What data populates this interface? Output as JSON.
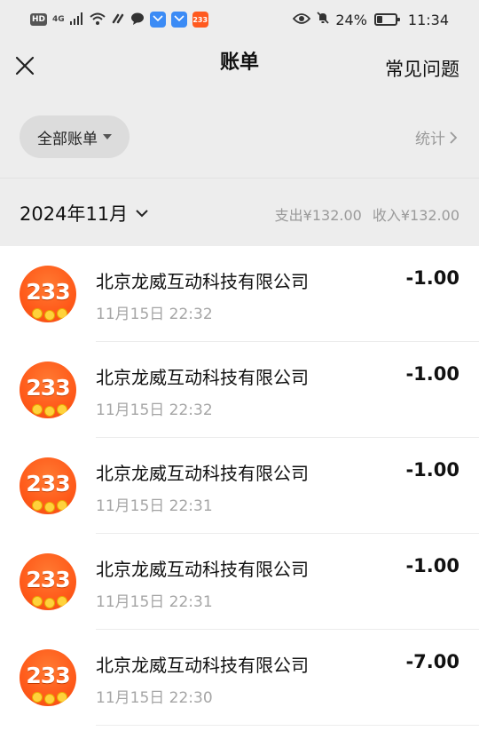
{
  "status_bar": {
    "hd": "HD",
    "network": "4G",
    "app_badge": "233",
    "battery_percent": "24%",
    "time": "11:34"
  },
  "navbar": {
    "title": "账单",
    "faq_label": "常见问题"
  },
  "filter": {
    "selected": "全部账单",
    "stats_label": "统计"
  },
  "month": {
    "label": "2024年11月",
    "expense": "支出¥132.00",
    "income": "收入¥132.00"
  },
  "bills": [
    {
      "merchant": "北京龙威互动科技有限公司",
      "time": "11月15日 22:32",
      "amount": "-1.00",
      "avatar_text": "233"
    },
    {
      "merchant": "北京龙威互动科技有限公司",
      "time": "11月15日 22:32",
      "amount": "-1.00",
      "avatar_text": "233"
    },
    {
      "merchant": "北京龙威互动科技有限公司",
      "time": "11月15日 22:31",
      "amount": "-1.00",
      "avatar_text": "233"
    },
    {
      "merchant": "北京龙威互动科技有限公司",
      "time": "11月15日 22:31",
      "amount": "-1.00",
      "avatar_text": "233"
    },
    {
      "merchant": "北京龙威互动科技有限公司",
      "time": "11月15日 22:30",
      "amount": "-7.00",
      "avatar_text": "233"
    }
  ],
  "colors": {
    "background": "#ededed",
    "avatar": "#ff5a1a",
    "muted_text": "#9a9a9a"
  }
}
